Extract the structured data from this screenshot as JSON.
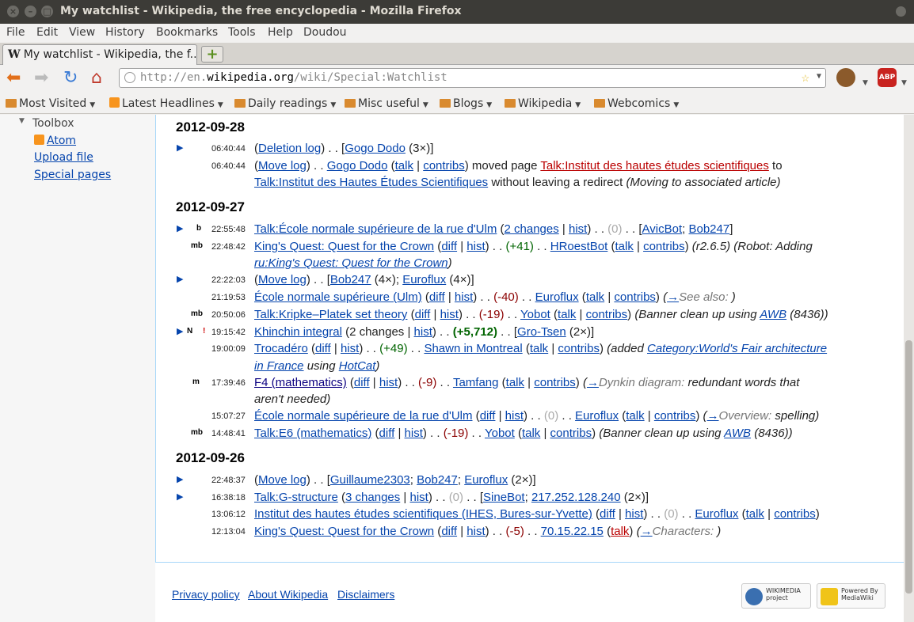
{
  "window": {
    "title": "My watchlist - Wikipedia, the free encyclopedia - Mozilla Firefox"
  },
  "menu": [
    "File",
    "Edit",
    "View",
    "History",
    "Bookmarks",
    "Tools",
    "Help",
    "Doudou"
  ],
  "tab": {
    "label": "My watchlist - Wikipedia, the f...",
    "new_tab": "+"
  },
  "url": {
    "prefix": "http://en.",
    "host": "wikipedia.org",
    "path": "/wiki/Special:Watchlist"
  },
  "extensions": {
    "abp": "ABP"
  },
  "bookmarks": [
    "Most Visited",
    "Latest Headlines",
    "Daily readings",
    "Misc useful",
    "Blogs",
    "Wikipedia",
    "Webcomics"
  ],
  "sidebar": {
    "toolbox": "Toolbox",
    "atom": "Atom",
    "upload": "Upload file",
    "special": "Special pages"
  },
  "days": [
    {
      "date": "2012-09-28"
    },
    {
      "date": "2012-09-27"
    },
    {
      "date": "2012-09-26"
    }
  ],
  "entries": {
    "e1": {
      "time": "06:40:44"
    },
    "e2": {
      "time": "06:40:44"
    },
    "e3": {
      "time": "22:55:48"
    },
    "e4": {
      "time": "22:48:42"
    },
    "e5": {
      "time": "22:22:03"
    },
    "e6": {
      "time": "21:19:53"
    },
    "e7": {
      "time": "20:50:06"
    },
    "e8": {
      "time": "19:15:42"
    },
    "e9": {
      "time": "19:00:09"
    },
    "e10": {
      "time": "17:39:46"
    },
    "e11": {
      "time": "15:07:27"
    },
    "e12": {
      "time": "14:48:41"
    },
    "e13": {
      "time": "22:48:37"
    },
    "e14": {
      "time": "16:38:18"
    },
    "e15": {
      "time": "13:06:12"
    },
    "e16": {
      "time": "12:13:04"
    }
  },
  "flags": {
    "b": "b",
    "mb": "mb",
    "N": "N",
    "bang": "!",
    "m": "m"
  },
  "footer": {
    "privacy": "Privacy policy",
    "about": "About Wikipedia",
    "disclaimers": "Disclaimers",
    "wikimedia": "WIKIMEDIA project",
    "mediawiki": "Powered By MediaWiki"
  }
}
